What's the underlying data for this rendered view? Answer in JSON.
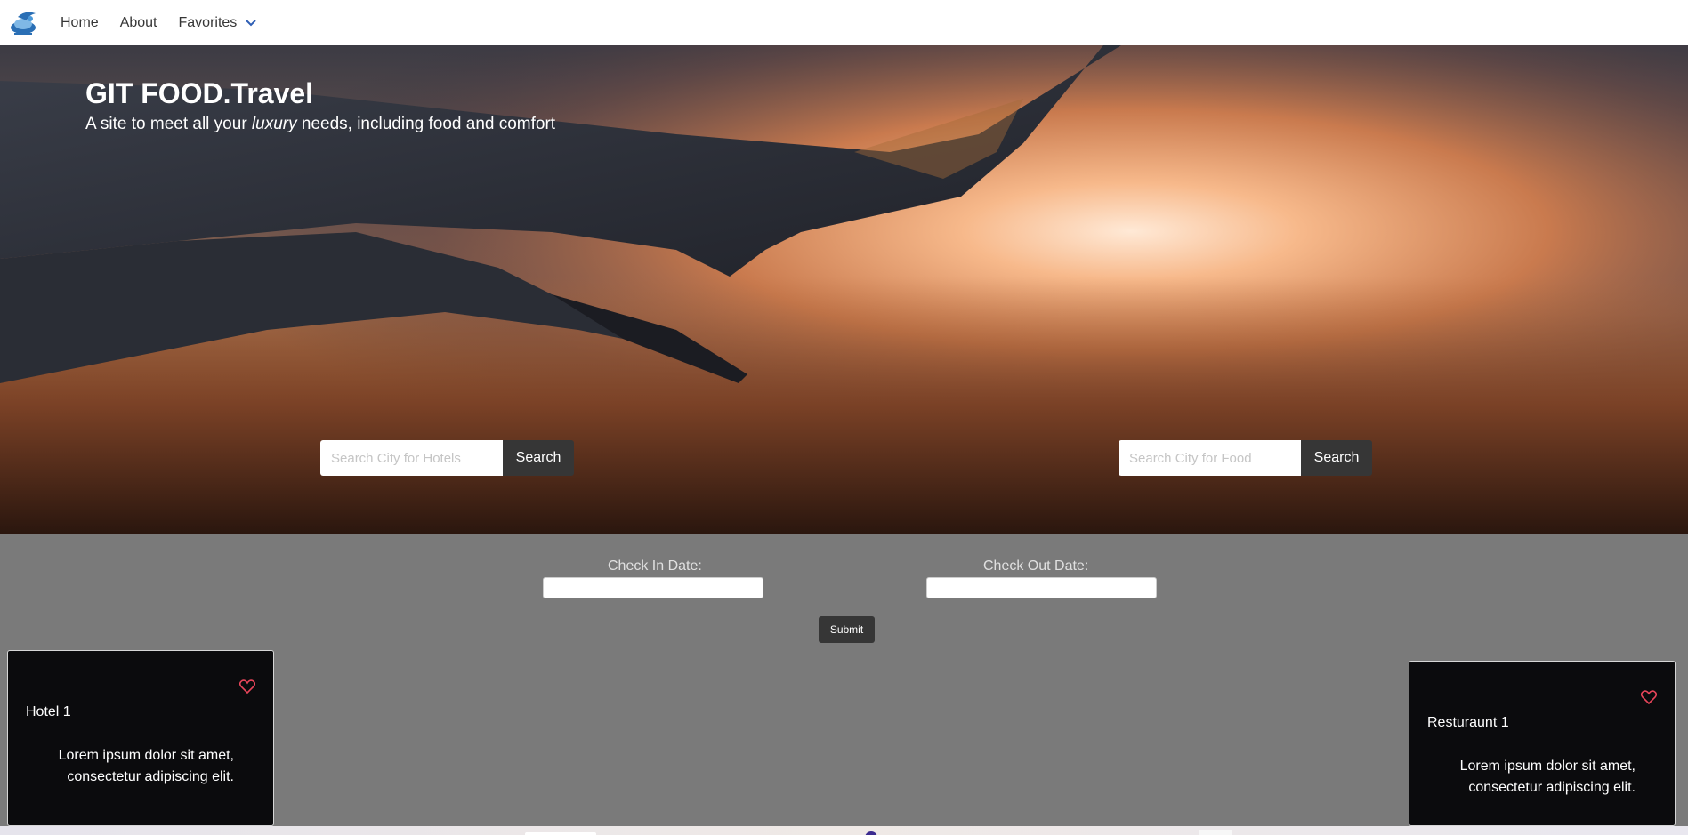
{
  "nav": {
    "items": [
      {
        "label": "Home"
      },
      {
        "label": "About"
      },
      {
        "label": "Favorites"
      }
    ]
  },
  "hero": {
    "title": "GIT FOOD.Travel",
    "subtitle_before": "A site to meet all your ",
    "subtitle_emphasis": "luxury",
    "subtitle_after": " needs, including food and comfort"
  },
  "search": {
    "hotels": {
      "placeholder": "Search City for Hotels",
      "button": "Search"
    },
    "food": {
      "placeholder": "Search City for Food",
      "button": "Search"
    }
  },
  "dates": {
    "check_in_label": "Check In Date:",
    "check_out_label": "Check Out Date:",
    "submit": "Submit"
  },
  "cards": {
    "hotel": {
      "title": "Hotel 1",
      "text": "Lorem ipsum dolor sit amet, consectetur adipiscing elit."
    },
    "restaurant": {
      "title": "Resturaunt 1",
      "text": "Lorem ipsum dolor sit amet, consectetur adipiscing elit."
    }
  },
  "colors": {
    "heart": "#e8455a",
    "navbar_bg": "#ffffff",
    "dark_button": "#363636",
    "section_bg": "#7a7a7a",
    "card_bg": "#0b0b0d"
  }
}
